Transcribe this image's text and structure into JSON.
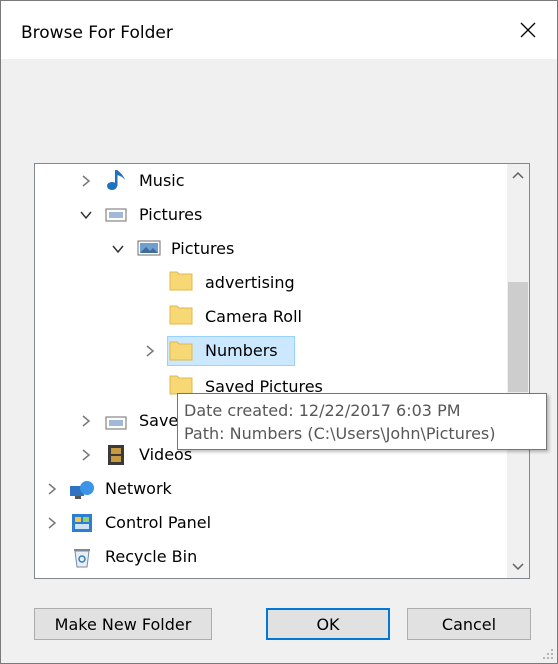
{
  "window": {
    "title": "Browse For Folder",
    "close_label": "×"
  },
  "tree": {
    "items": [
      {
        "label": "Music"
      },
      {
        "label": "Pictures"
      },
      {
        "label": "Pictures"
      },
      {
        "label": "advertising"
      },
      {
        "label": "Camera Roll"
      },
      {
        "label": "Numbers"
      },
      {
        "label": "Saved Pictures"
      },
      {
        "label": "Saved"
      },
      {
        "label": "Videos"
      },
      {
        "label": "Network"
      },
      {
        "label": "Control Panel"
      },
      {
        "label": "Recycle Bin"
      }
    ],
    "selected": "Numbers"
  },
  "tooltip": {
    "line1": "Date created: 12/22/2017 6:03 PM",
    "line2": "Path: Numbers (C:\\Users\\John\\Pictures)"
  },
  "buttons": {
    "make_new_folder": "Make New Folder",
    "ok": "OK",
    "cancel": "Cancel"
  },
  "colors": {
    "selection": "#cce8ff",
    "selection_border": "#99d1ff",
    "default_button_border": "#0078d7"
  }
}
